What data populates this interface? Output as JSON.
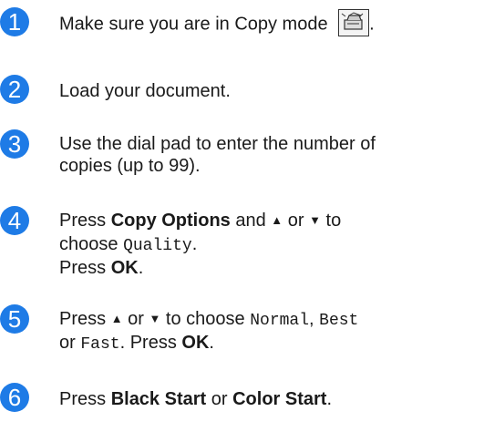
{
  "steps": [
    {
      "number": "1",
      "text": "Make sure you are in Copy mode",
      "trailing": ".",
      "icon": "copy-mode-icon"
    },
    {
      "number": "2",
      "text": "Load your document."
    },
    {
      "number": "3",
      "line1": "Use the dial pad to enter the number of",
      "line2": "copies (up to 99)."
    },
    {
      "number": "4",
      "press": "Press",
      "copy_options": "Copy Options",
      "and": "and",
      "up": "▲",
      "or": "or",
      "down": "▼",
      "to": "to",
      "choose": "choose",
      "quality": "Quality",
      "period": ".",
      "press2": "Press",
      "ok": "OK",
      "period2": "."
    },
    {
      "number": "5",
      "press": "Press",
      "up": "▲",
      "or": "or",
      "down": "▼",
      "to_choose": "to choose",
      "normal": "Normal",
      "comma": ",",
      "best": "Best",
      "or2": "or",
      "fast": "Fast",
      "period": ". Press",
      "ok": "OK",
      "period2": "."
    },
    {
      "number": "6",
      "press": "Press",
      "black_start": "Black Start",
      "or": "or",
      "color_start": "Color Start",
      "period": "."
    }
  ]
}
